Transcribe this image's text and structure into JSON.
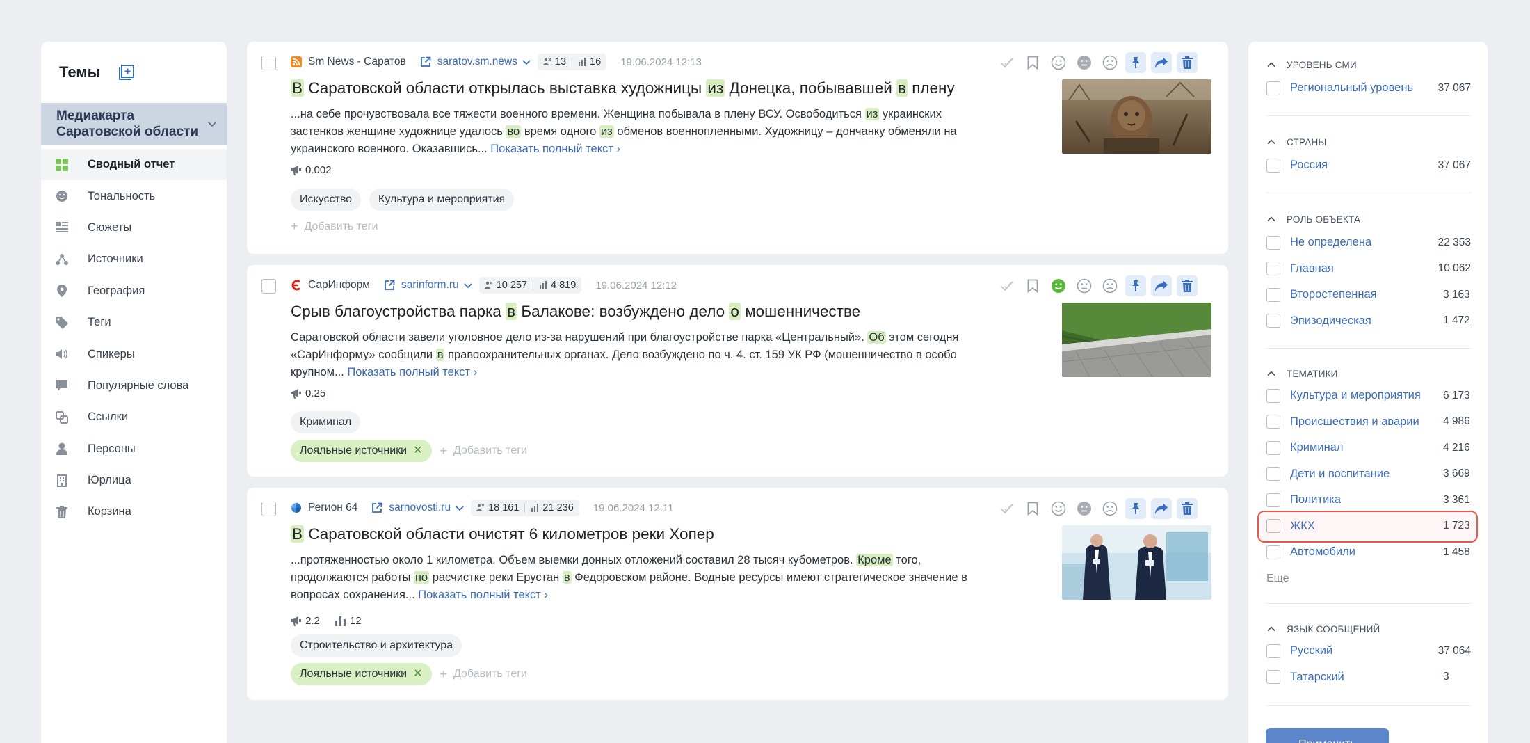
{
  "sidebar": {
    "title": "Темы",
    "project": "Медиакарта Саратовской области",
    "items": [
      {
        "label": "Сводный отчет",
        "icon": "grid-icon"
      },
      {
        "label": "Тональность",
        "icon": "smile-icon"
      },
      {
        "label": "Сюжеты",
        "icon": "list-icon"
      },
      {
        "label": "Источники",
        "icon": "network-icon"
      },
      {
        "label": "География",
        "icon": "pin-icon"
      },
      {
        "label": "Теги",
        "icon": "tag-icon"
      },
      {
        "label": "Спикеры",
        "icon": "speaker-icon"
      },
      {
        "label": "Популярные слова",
        "icon": "chat-icon"
      },
      {
        "label": "Ссылки",
        "icon": "link-icon"
      },
      {
        "label": "Персоны",
        "icon": "person-icon"
      },
      {
        "label": "Юрлица",
        "icon": "building-icon"
      },
      {
        "label": "Корзина",
        "icon": "trash-icon"
      }
    ]
  },
  "cards": [
    {
      "source": "Sm News - Саратов",
      "domain": "saratov.sm.news",
      "audience": "13",
      "views": "16",
      "date": "19.06.2024 12:13",
      "title_parts": [
        "В",
        " Саратовской области открылась выставка художницы ",
        "из",
        " Донецка, побывавшей ",
        "в",
        " плену"
      ],
      "snippet_parts": [
        "...на себе прочувствовала все тяжести военного времени. Женщина побывала в плену ВСУ. Освободиться ",
        "из",
        " украинских застенков женщине художнице удалось ",
        "во",
        " время одного ",
        "из",
        " обменов военнопленными. Художницу – дончанку обменяли на украинского военного. Оказавшись... "
      ],
      "more": "Показать полный текст ›",
      "reach": "0.002",
      "tags": [
        "Искусство",
        "Культура и мероприятия"
      ],
      "add_tag": "Добавить теги"
    },
    {
      "source": "СарИнформ",
      "domain": "sarinform.ru",
      "audience": "10 257",
      "views": "4 819",
      "date": "19.06.2024 12:12",
      "title_parts": [
        "Срыв благоустройства парка ",
        "в",
        " Балакове: возбуждено дело ",
        "о",
        " мошенничестве"
      ],
      "snippet_parts": [
        "Саратовской области завели уголовное дело из-за нарушений при благоустройстве парка «Центральный». ",
        "Об",
        " этом сегодня «СарИнформу» сообщили ",
        "в",
        " правоохранительных органах. Дело возбуждено по ч. 4. ст. 159 УК РФ (мошенничество в особо крупном... "
      ],
      "more": "Показать полный текст ›",
      "reach": "0.25",
      "tags": [
        "Криминал"
      ],
      "green_tag": "Лояльные источники",
      "add_tag": "Добавить теги"
    },
    {
      "source": "Регион 64",
      "domain": "sarnovosti.ru",
      "audience": "18 161",
      "views": "21 236",
      "date": "19.06.2024 12:11",
      "title_parts": [
        "В",
        " Саратовской области очистят 6 километров реки Хопер"
      ],
      "snippet_parts": [
        "...протяженностью около 1 километра. Объем выемки донных отложений составил 28 тысяч кубометров. ",
        "Кроме",
        " того, продолжаются работы ",
        "по",
        " расчистке реки Ерустан ",
        "в",
        " Федоровском районе. Водные ресурсы имеют стратегическое значение в вопросах сохранения... "
      ],
      "more": "Показать полный текст ›",
      "reach": "2.2",
      "engagement": "12",
      "tags": [
        "Строительство и архитектура"
      ],
      "green_tag": "Лояльные источники",
      "add_tag": "Добавить теги"
    }
  ],
  "filters": {
    "groups": [
      {
        "title": "УРОВЕНЬ СМИ",
        "rows": [
          {
            "label": "Региональный уровень",
            "count": "37 067"
          }
        ]
      },
      {
        "title": "СТРАНЫ",
        "rows": [
          {
            "label": "Россия",
            "count": "37 067"
          }
        ]
      },
      {
        "title": "РОЛЬ ОБЪЕКТА",
        "rows": [
          {
            "label": "Не определена",
            "count": "22 353"
          },
          {
            "label": "Главная",
            "count": "10 062"
          },
          {
            "label": "Второстепенная",
            "count": "3 163"
          },
          {
            "label": "Эпизодическая",
            "count": "1 472"
          }
        ]
      },
      {
        "title": "ТЕМАТИКИ",
        "rows": [
          {
            "label": "Культура и мероприятия",
            "count": "6 173"
          },
          {
            "label": "Происшествия и аварии",
            "count": "4 986"
          },
          {
            "label": "Криминал",
            "count": "4 216"
          },
          {
            "label": "Дети и воспитание",
            "count": "3 669"
          },
          {
            "label": "Политика",
            "count": "3 361"
          },
          {
            "label": "ЖКХ",
            "count": "1 723"
          },
          {
            "label": "Автомобили",
            "count": "1 458"
          }
        ],
        "more": "Еще"
      },
      {
        "title": "ЯЗЫК СООБЩЕНИЙ",
        "rows": [
          {
            "label": "Русский",
            "count": "37 064"
          },
          {
            "label": "Татарский",
            "count": "3"
          }
        ]
      }
    ],
    "apply_button": "Применить"
  },
  "colors": {
    "accent": "#3a6db8",
    "highlight": "#d7efc0",
    "selection_outline": "#e9574a",
    "positive": "#5cb83a"
  }
}
